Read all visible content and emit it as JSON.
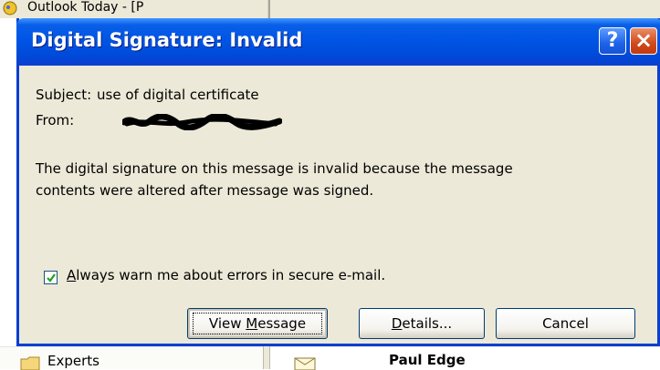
{
  "background": {
    "app_title": "Outlook Today - [P",
    "folder_label": "Experts",
    "sender": "Paul Edge"
  },
  "dialog": {
    "title": "Digital Signature: Invalid",
    "help_symbol": "?",
    "close_symbol": "×",
    "subject_label": "Subject:",
    "subject_value": "use of digital certificate",
    "from_label": "From:",
    "from_value": "",
    "message_line1": "The digital signature on this message is invalid because the message",
    "message_line2": "contents were altered after message was signed.",
    "checkbox": {
      "checked": true,
      "label_accel": "A",
      "label_rest": "lways warn me about errors in secure e-mail."
    },
    "buttons": {
      "view_pre": "View ",
      "view_accel": "M",
      "view_post": "essage",
      "details_accel": "D",
      "details_post": "etails...",
      "cancel": "Cancel"
    }
  },
  "colors": {
    "titlebar": "#0055e5",
    "dialog_bg": "#ece9d8",
    "close_button": "#d04a1a",
    "button_border": "#003c74"
  }
}
